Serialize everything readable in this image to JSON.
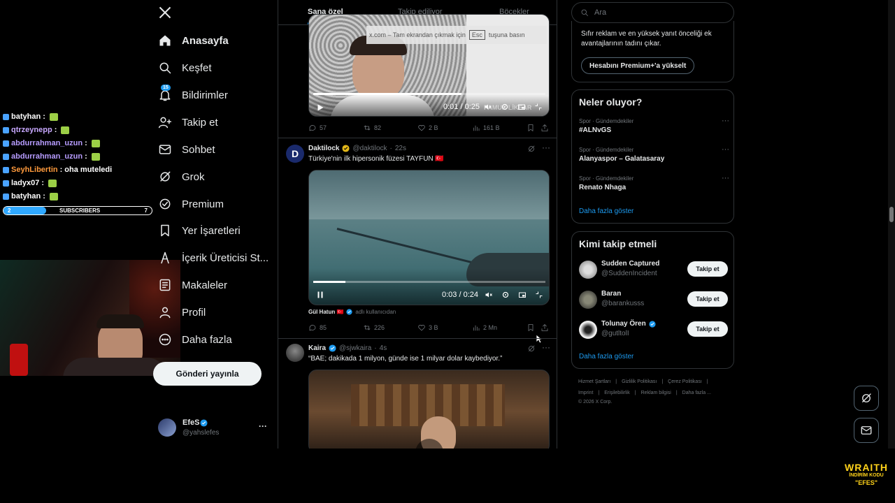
{
  "chat": [
    {
      "name": "batyhan",
      "sep": ":",
      "msg": "",
      "color": "#ffffff"
    },
    {
      "name": "qtrzeynepp",
      "sep": ":",
      "msg": "",
      "color": "#c8a8ff"
    },
    {
      "name": "abdurrahman_uzun",
      "sep": ":",
      "msg": "",
      "color": "#b79cff"
    },
    {
      "name": "abdurrahman_uzun",
      "sep": ":",
      "msg": "",
      "color": "#b79cff"
    },
    {
      "name": "SeyhLibertin",
      "sep": ":",
      "msg": "oha muteledi",
      "color": "#ff9a3c"
    },
    {
      "name": "ladyx07",
      "sep": ":",
      "msg": "",
      "color": "#ffffff"
    },
    {
      "name": "batyhan",
      "sep": ":",
      "msg": "",
      "color": "#ffffff"
    }
  ],
  "subs": {
    "current": "2",
    "label": "SUBSCRIBERS",
    "goal": "7",
    "fill": 0.29
  },
  "nav": {
    "home": "Anasayfa",
    "explore": "Keşfet",
    "notifications": "Bildirimler",
    "notif_count": "15",
    "follow": "Takip et",
    "messages": "Sohbet",
    "grok": "Grok",
    "premium": "Premium",
    "bookmarks": "Yer İşaretleri",
    "creator": "İçerik Üreticisi St...",
    "articles": "Makaleler",
    "profile": "Profil",
    "more": "Daha fazla",
    "post": "Gönderi yayınla"
  },
  "account": {
    "name": "EfeS",
    "handle": "@yahslefes",
    "more": "···"
  },
  "tabs": {
    "foryou": "Sana özel",
    "following": "Takip ediliyor",
    "bugs": "Böcekler"
  },
  "tweet1": {
    "fullscreen_hint_prefix": "x.com – Tam ekrandan çıkmak için",
    "esc": "Esc",
    "fullscreen_hint_suffix": "tuşuna basın",
    "time": "0:01 / 0:25",
    "progress": 0.64,
    "watermark": "PAMUK LİKEAR",
    "replies": "57",
    "retweets": "82",
    "likes": "2 B",
    "views": "161 B"
  },
  "tweet2": {
    "author": "Daktilock",
    "handle": "@daktilock",
    "time": "22s",
    "avatar_letter": "D",
    "text": "Türkiye'nin ilk hipersonik füzesi TAYFUN 🇹🇷",
    "video_time": "0:03 / 0:24",
    "progress": 0.14,
    "tagged_user": "Gül Hatun 🇹🇷",
    "tagged_suffix": "adlı kullanıcıdan",
    "replies": "85",
    "retweets": "226",
    "likes": "3 B",
    "views": "2 Mn"
  },
  "tweet3": {
    "author": "Kaira",
    "handle": "@sjwkaira",
    "time": "4s",
    "text": "“BAE; dakikada 1 milyon, günde ise 1 milyar dolar kaybediyor.”"
  },
  "search": {
    "placeholder": "Ara"
  },
  "premium": {
    "text": "Sıfır reklam ve en yüksek yanıt önceliği ek avantajlarının tadını çıkar.",
    "button": "Hesabını Premium+'a yükselt"
  },
  "trends": {
    "title": "Neler oluyor?",
    "items": [
      {
        "category": "Spor · Gündemdekiler",
        "name": "#ALNvGS"
      },
      {
        "category": "Spor · Gündemdekiler",
        "name": "Alanyaspor – Galatasaray"
      },
      {
        "category": "Spor · Gündemdekiler",
        "name": "Renato Nhaga"
      }
    ],
    "more": "Daha fazla göster"
  },
  "who": {
    "title": "Kimi takip etmeli",
    "items": [
      {
        "name": "Sudden Captured",
        "handle": "@SuddenIncident",
        "btn": "Takip et"
      },
      {
        "name": "Baran",
        "handle": "@barankusss",
        "btn": "Takip et"
      },
      {
        "name": "Tolunay Ören",
        "handle": "@gutltolI",
        "btn": "Takip et"
      }
    ],
    "more": "Daha fazla göster"
  },
  "footer": {
    "l1": [
      "Hizmet Şartları",
      "Gizlilik Politikası",
      "Çerez Politikası"
    ],
    "l2": [
      "Imprint",
      "Erişilebilirlik",
      "Reklam bilgisi",
      "Daha fazla ..."
    ],
    "copy": "© 2026 X Corp."
  },
  "sponsor": {
    "brand": "WRAITH",
    "line": "İNDİRİM KODU",
    "code": "\"EFES\""
  },
  "colors": {
    "accent": "#1d9bf0",
    "verified_gold": "#e2b719",
    "bg": "#000000"
  }
}
